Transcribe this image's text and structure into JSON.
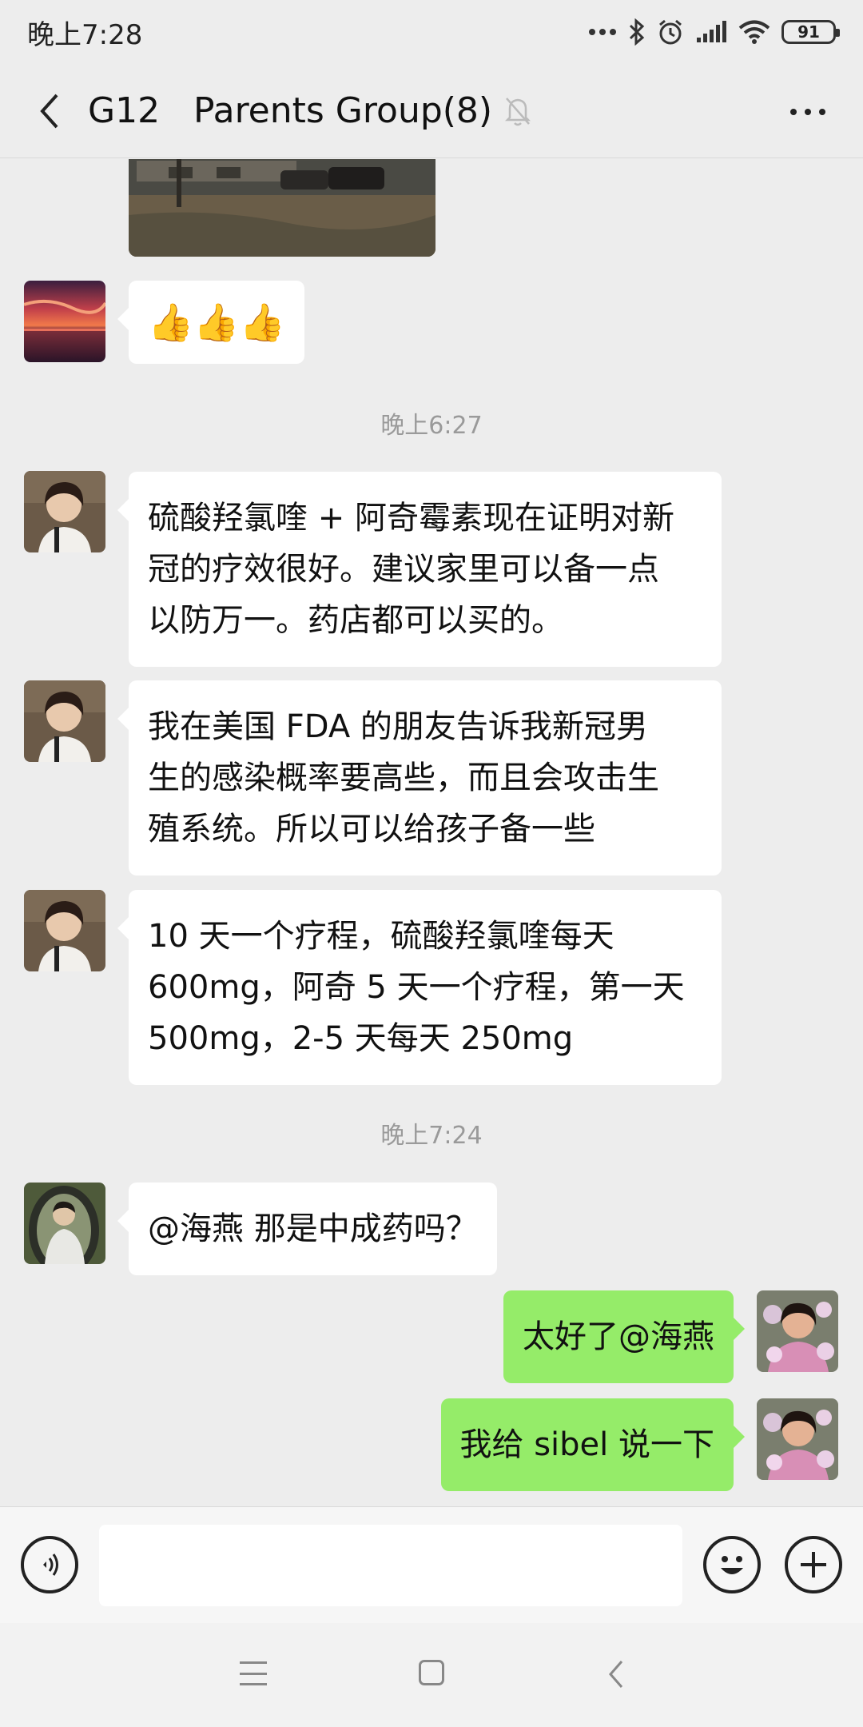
{
  "status_bar": {
    "time": "晚上7:28",
    "battery": "91",
    "icons": [
      "more-dots-icon",
      "bluetooth-icon",
      "alarm-icon",
      "signal-icon",
      "wifi-icon",
      "battery-icon"
    ]
  },
  "header": {
    "title": "G12   Parents Group(8)",
    "icons": [
      "back-arrow-icon",
      "mute-bell-icon",
      "more-icon"
    ]
  },
  "chat": {
    "messages": [
      {
        "type": "image",
        "sender_side": "left",
        "description": ""
      },
      {
        "type": "text",
        "sender_side": "left",
        "avatar": "sunset-avatar",
        "text": "👍👍👍"
      },
      {
        "type": "timestamp",
        "text": "晚上6:27"
      },
      {
        "type": "text",
        "sender_side": "left",
        "avatar": "woman-avatar",
        "lines": [
          "硫酸羟氯喹 + 阿奇霉素现在证明对新",
          "冠的疗效很好。建议家里可以备一点",
          "以防万一。药店都可以买的。"
        ]
      },
      {
        "type": "text",
        "sender_side": "left",
        "avatar": "woman-avatar",
        "lines": [
          "我在美国 FDA 的朋友告诉我新冠男",
          "生的感染概率要高些，而且会攻击生",
          "殖系统。所以可以给孩子备一些"
        ]
      },
      {
        "type": "text",
        "sender_side": "left",
        "avatar": "woman-avatar",
        "lines": [
          "10 天一个疗程，硫酸羟氯喹每天",
          "600mg，阿奇 5 天一个疗程，第一天",
          "500mg，2-5 天每天 250mg"
        ]
      },
      {
        "type": "timestamp",
        "text": "晚上7:24"
      },
      {
        "type": "text",
        "sender_side": "left",
        "avatar": "child-avatar",
        "text": "@海燕  那是中成药吗？"
      },
      {
        "type": "text",
        "sender_side": "right",
        "avatar": "self-avatar",
        "text": "太好了@海燕"
      },
      {
        "type": "text",
        "sender_side": "right",
        "avatar": "self-avatar",
        "text": "我给 sibel 说一下"
      }
    ]
  },
  "input_bar": {
    "value": "",
    "icons": [
      "voice-icon",
      "emoji-icon",
      "plus-icon"
    ]
  },
  "nav_bar": {
    "icons": [
      "menu-icon",
      "home-icon",
      "back-icon"
    ]
  },
  "colors": {
    "background": "#ededed",
    "self_bubble": "#95ec69",
    "other_bubble": "#ffffff",
    "timestamp": "#9a9a9a"
  }
}
